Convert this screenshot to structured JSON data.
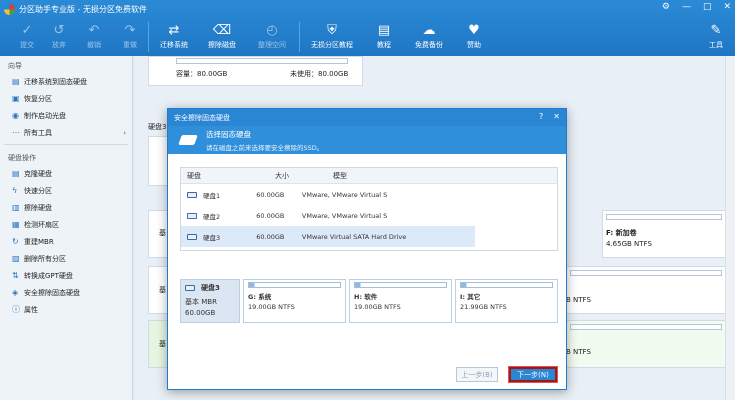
{
  "app": {
    "title": "分区助手专业版 - 无损分区免费软件",
    "win_ctrls": [
      "⚙",
      "—",
      "□",
      "✕"
    ]
  },
  "toolbar": {
    "buttons": [
      {
        "label": "提交",
        "icon": "✓",
        "disabled": true
      },
      {
        "label": "放弃",
        "icon": "↺",
        "disabled": true
      },
      {
        "label": "撤销",
        "icon": "↶",
        "disabled": true
      },
      {
        "label": "重做",
        "icon": "↷",
        "disabled": true
      },
      {
        "label": "迁移系统",
        "icon": "⇄",
        "disabled": false
      },
      {
        "label": "擦除磁盘",
        "icon": "⌫",
        "disabled": false
      },
      {
        "label": "整理空间",
        "icon": "◴",
        "disabled": true
      },
      {
        "label": "无损分区教程",
        "icon": "⛨",
        "disabled": false
      },
      {
        "label": "教程",
        "icon": "▤",
        "disabled": false
      },
      {
        "label": "免费备份",
        "icon": "☁",
        "disabled": false
      },
      {
        "label": "赞助",
        "icon": "♥",
        "disabled": false
      }
    ],
    "tools_label": "工具"
  },
  "sidebar": {
    "wizard_title": "向导",
    "wizard_items": [
      "迁移系统到固态硬盘",
      "恢复分区",
      "制作启动光盘",
      "所有工具"
    ],
    "disk_title": "硬盘操作",
    "disk_items": [
      "克隆硬盘",
      "快速分区",
      "擦除硬盘",
      "检测坏扇区",
      "重建MBR",
      "删除所有分区",
      "转换成GPT硬盘",
      "安全擦除固态硬盘",
      "属性"
    ]
  },
  "background": {
    "capacity": "容量：80.00GB",
    "unused": "未使用：80.00GB",
    "disk3_label": "硬盘3",
    "card_labels": [
      "基",
      "基",
      "基"
    ],
    "new_volume": "F: 新加卷",
    "ntfs1": "4.65GB NTFS",
    "ntfs2": "B NTFS",
    "ntfs3": "B NTFS"
  },
  "modal": {
    "title": "安全擦除固态硬盘",
    "header_title": "选择固态硬盘",
    "header_sub": "请在磁盘之前来选择要安全擦除的SSD。",
    "columns": [
      "硬盘",
      "大小",
      "模型"
    ],
    "rows": [
      {
        "disk": "硬盘1",
        "size": "60.00GB",
        "model": "VMware, VMware Virtual S",
        "selected": false
      },
      {
        "disk": "硬盘2",
        "size": "60.00GB",
        "model": "VMware, VMware Virtual S",
        "selected": false
      },
      {
        "disk": "硬盘3",
        "size": "60.00GB",
        "model": "VMware Virtual SATA Hard Drive",
        "selected": true
      }
    ],
    "diskmap": {
      "name": "硬盘3",
      "type": "基本 MBR",
      "size": "60.00GB",
      "partitions": [
        {
          "name": "G: 系统",
          "detail": "19.00GB NTFS"
        },
        {
          "name": "H: 软件",
          "detail": "19.00GB NTFS"
        },
        {
          "name": "I: 其它",
          "detail": "21.99GB NTFS"
        }
      ]
    },
    "prev_label": "上一步(B)",
    "next_label": "下一步(N)"
  }
}
